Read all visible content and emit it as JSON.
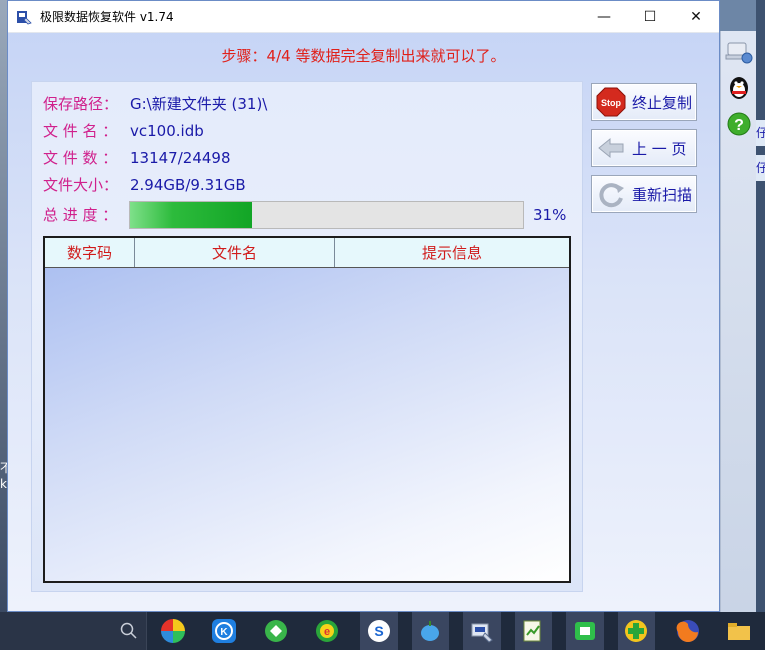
{
  "window": {
    "title": "极限数据恢复软件 v1.74",
    "minimize": "—",
    "maximize": "☐",
    "close": "✕"
  },
  "step_text": "步骤：4/4 等数据完全复制出来就可以了。",
  "info": {
    "save_path_label": "保存路径：",
    "save_path_value": "G:\\新建文件夹 (31)\\",
    "file_name_label": "文 件 名 ：",
    "file_name_value": "vc100.idb",
    "file_count_label": "文 件 数 ：",
    "file_count_value": "13147/24498",
    "file_size_label": "文件大小：",
    "file_size_value": "2.94GB/9.31GB",
    "progress_label": "总 进 度 ：",
    "progress_percent_text": "31%",
    "progress_fraction": 0.31
  },
  "table": {
    "columns": [
      "数字码",
      "文件名",
      "提示信息"
    ]
  },
  "buttons": {
    "stop_copy": "终止复制",
    "stop_icon_text": "Stop",
    "prev_page": "上 一 页",
    "rescan": "重新扫描"
  },
  "desktop": {
    "left_fragment_1": "不",
    "left_fragment_2": "k",
    "right_fragment": "仔"
  },
  "colors": {
    "step_red": "#e0201a",
    "label_magenta": "#d0208c",
    "value_blue": "#1a1aa8",
    "progress_green": "#12a526"
  },
  "icons": [
    "app-icon",
    "stop-icon",
    "back-arrow-icon",
    "refresh-icon",
    "network-settings-icon",
    "qq-penguin-icon",
    "help-icon",
    "search-icon"
  ]
}
